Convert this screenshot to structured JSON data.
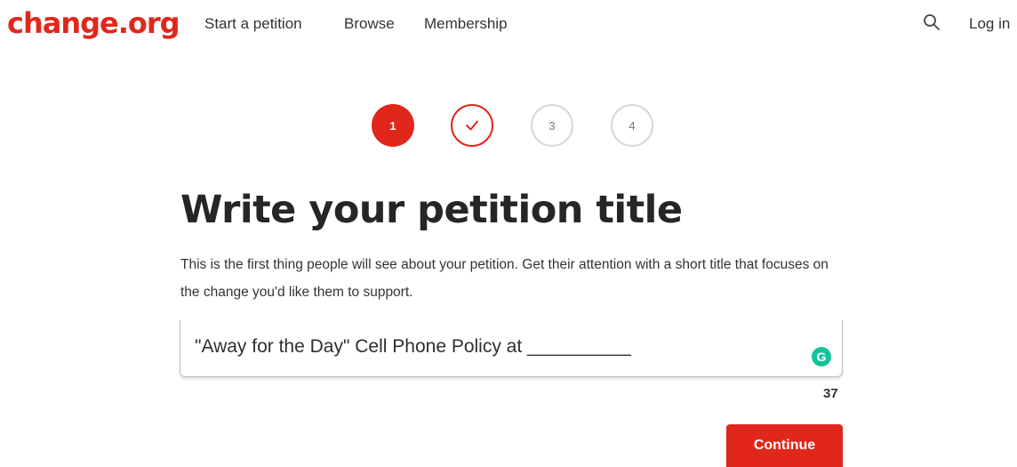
{
  "header": {
    "logo": "change.org",
    "nav": [
      "Start a petition",
      "Browse",
      "Membership"
    ],
    "search_icon": "search-icon",
    "login_label": "Log in"
  },
  "stepper": {
    "steps": [
      {
        "label": "1",
        "state": "active"
      },
      {
        "label": "",
        "state": "completed",
        "icon": "check-icon"
      },
      {
        "label": "3",
        "state": "pending"
      },
      {
        "label": "4",
        "state": "pending"
      }
    ]
  },
  "main": {
    "title": "Write your petition title",
    "description": "This is the first thing people will see about your petition. Get their attention with a short title that focuses on the change you'd like them to support.",
    "input": {
      "value": "\"Away for the Day\" Cell Phone Policy at __________",
      "grammarly_icon": "grammarly-icon"
    },
    "char_count": "37",
    "continue_label": "Continue"
  },
  "colors": {
    "brand": "#e1261c",
    "grammarly": "#15c39a"
  }
}
